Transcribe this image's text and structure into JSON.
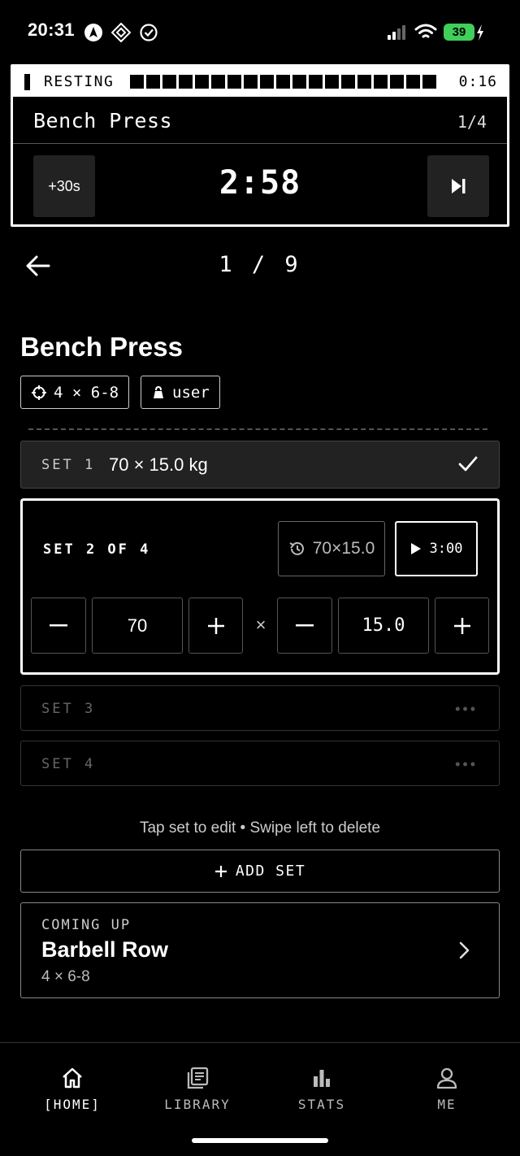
{
  "status_bar": {
    "time": "20:31",
    "battery": "39"
  },
  "rest_timer": {
    "state_label": "RESTING",
    "elapsed": "0:16",
    "progress_fraction": 1.0,
    "exercise": "Bench Press",
    "exercise_count": "1/4",
    "add_time_label": "+30s",
    "remaining": "2:58"
  },
  "nav": {
    "page": "1 / 9"
  },
  "exercise": {
    "name": "Bench Press",
    "target": "4 × 6-8",
    "owner": "user"
  },
  "sets": {
    "completed": {
      "label": "SET 1",
      "value": "70 × 15.0 kg"
    },
    "active": {
      "label": "SET 2 OF 4",
      "history": "70×15.0",
      "rest_timer": "3:00",
      "weight": "70",
      "times": "×",
      "reps": "15.0"
    },
    "pending": [
      {
        "label": "SET 3",
        "dots": "•••"
      },
      {
        "label": "SET 4",
        "dots": "•••"
      }
    ]
  },
  "hint": "Tap set to edit • Swipe left to delete",
  "add_set_label": "ADD SET",
  "coming_up": {
    "label": "COMING UP",
    "name": "Barbell Row",
    "target": "4 × 6-8"
  },
  "tabs": [
    {
      "label": "[HOME]",
      "icon": "home-icon",
      "active": true
    },
    {
      "label": "LIBRARY",
      "icon": "library-icon",
      "active": false
    },
    {
      "label": "STATS",
      "icon": "stats-icon",
      "active": false
    },
    {
      "label": "ME",
      "icon": "person-icon",
      "active": false
    }
  ]
}
